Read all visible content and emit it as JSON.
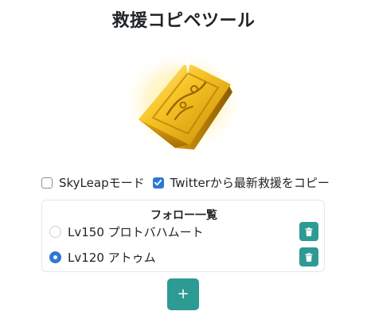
{
  "app": {
    "title": "救援コピペツール"
  },
  "options": {
    "skyleap": {
      "label": "SkyLeapモード",
      "checked": false
    },
    "twitter": {
      "label": "Twitterから最新救援をコピー",
      "checked": true
    }
  },
  "follow_list": {
    "title": "フォロー一覧",
    "items": [
      {
        "label": "Lv150 プロトバハムート",
        "selected": false,
        "delete_icon": "trash-icon"
      },
      {
        "label": "Lv120 アトゥム",
        "selected": true,
        "delete_icon": "trash-icon"
      }
    ]
  },
  "add_button": {
    "label": "+"
  },
  "colors": {
    "accent": "#2e9a94",
    "checkbox_checked": "#2f78d3",
    "text": "#212529"
  }
}
